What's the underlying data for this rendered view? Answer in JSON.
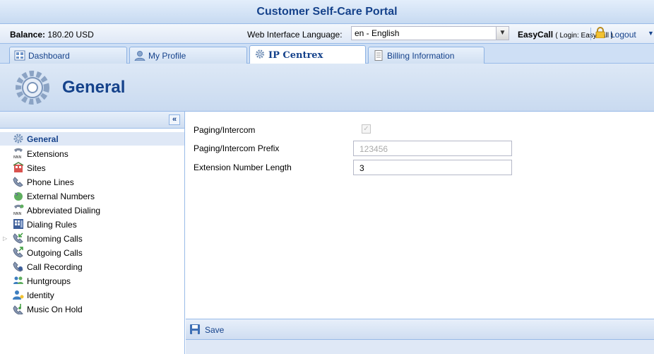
{
  "app": {
    "title": "Customer Self-Care Portal"
  },
  "infobar": {
    "balance_label": "Balance:",
    "balance_value": "180.20 USD",
    "language_label": "Web Interface Language:",
    "language_value": "en - English",
    "user_name": "EasyCall",
    "user_login": "( Login: EasyCall )",
    "logout_label": "Logout"
  },
  "tabs": [
    {
      "label": "Dashboard",
      "icon": "dashboard-icon"
    },
    {
      "label": "My Profile",
      "icon": "user-icon"
    },
    {
      "label": "IP Centrex",
      "icon": "gear-icon",
      "active": true
    },
    {
      "label": "Billing Information",
      "icon": "document-icon"
    }
  ],
  "header": {
    "title": "General"
  },
  "sidebar": {
    "collapse_label": "«",
    "items": [
      {
        "label": "General",
        "icon": "gear-icon",
        "selected": true
      },
      {
        "label": "Extensions",
        "icon": "phone-icon"
      },
      {
        "label": "Sites",
        "icon": "building-icon"
      },
      {
        "label": "Phone Lines",
        "icon": "phone-line-icon"
      },
      {
        "label": "External Numbers",
        "icon": "external-number-icon"
      },
      {
        "label": "Abbreviated Dialing",
        "icon": "abbreviated-dialing-icon"
      },
      {
        "label": "Dialing Rules",
        "icon": "dialing-rules-icon"
      },
      {
        "label": "Incoming Calls",
        "icon": "incoming-calls-icon",
        "expandable": true
      },
      {
        "label": "Outgoing Calls",
        "icon": "outgoing-calls-icon"
      },
      {
        "label": "Call Recording",
        "icon": "call-recording-icon"
      },
      {
        "label": "Huntgroups",
        "icon": "huntgroup-icon"
      },
      {
        "label": "Identity",
        "icon": "identity-icon"
      },
      {
        "label": "Music On Hold",
        "icon": "music-on-hold-icon"
      }
    ]
  },
  "form": {
    "paging_label": "Paging/Intercom",
    "paging_checked": true,
    "prefix_label": "Paging/Intercom Prefix",
    "prefix_value": "123456",
    "ext_length_label": "Extension Number Length",
    "ext_length_value": "3"
  },
  "footer": {
    "save_label": "Save"
  },
  "colors": {
    "accent": "#15428b",
    "panel": "#dfe8f6",
    "border": "#99bbe8"
  }
}
